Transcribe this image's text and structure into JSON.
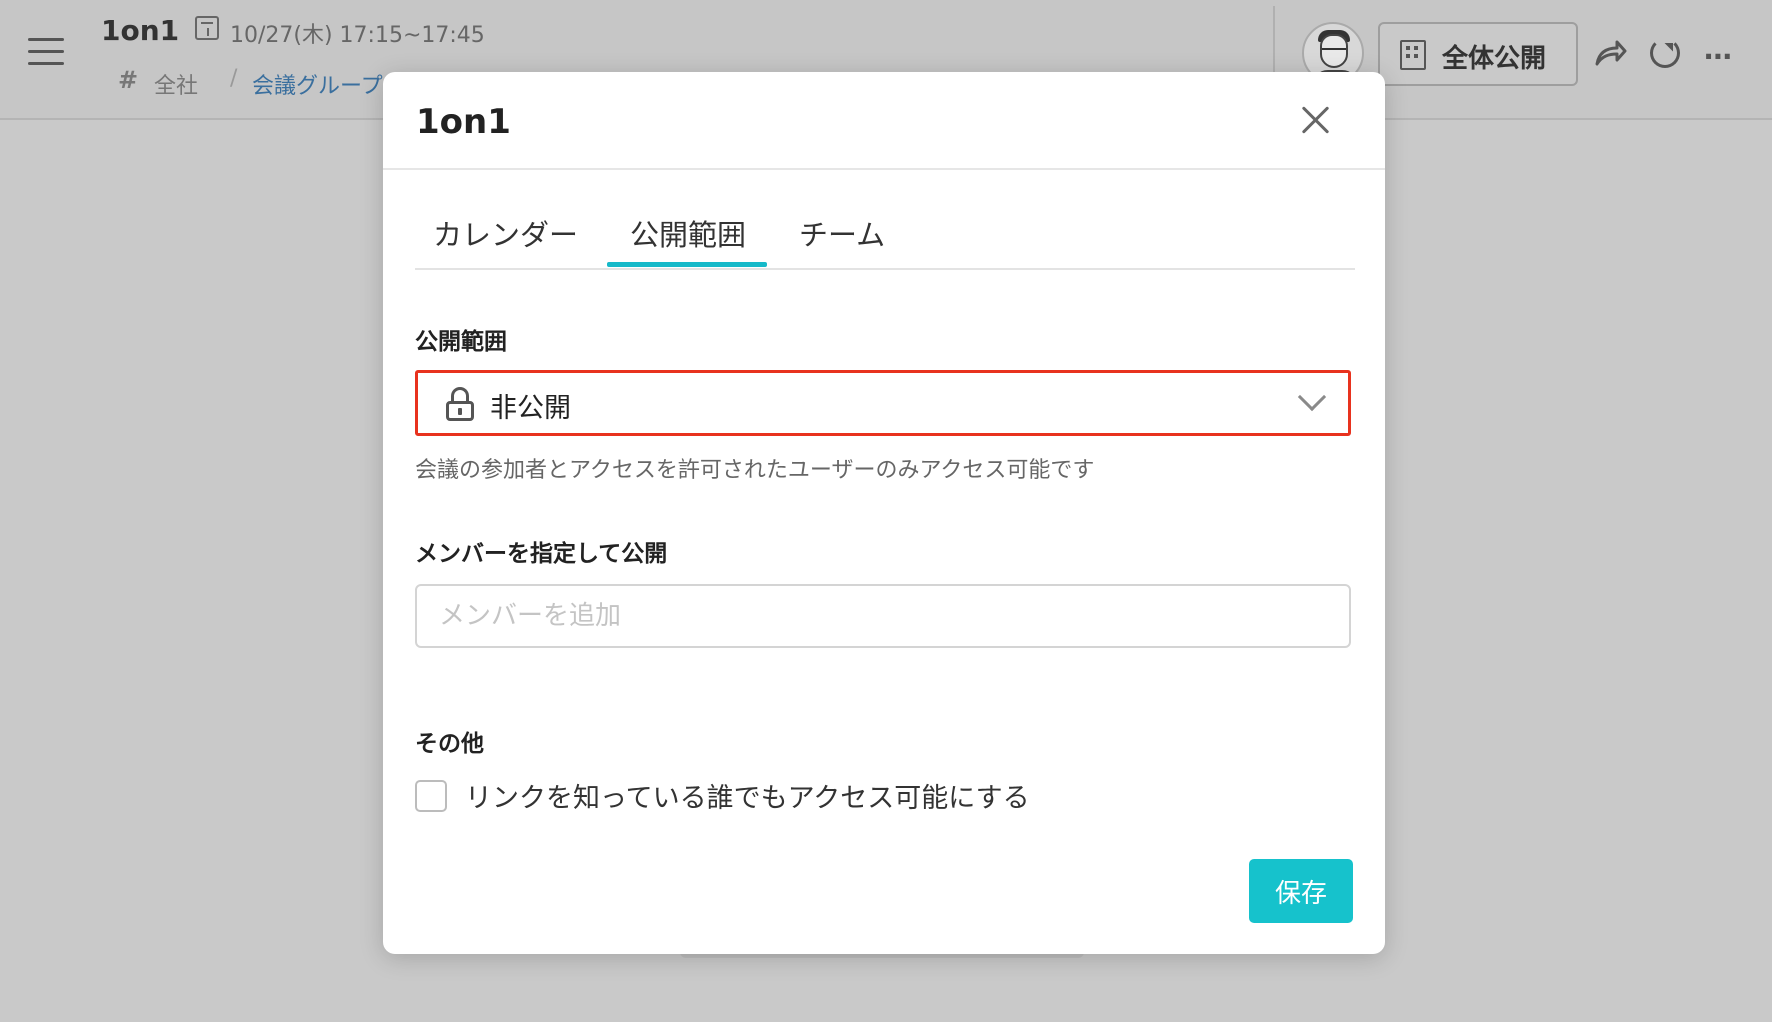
{
  "background": {
    "title": "1on1",
    "datetime": "10/27(木) 17:15~17:45",
    "breadcrumb": {
      "hash": "#",
      "company": "全社",
      "separator": "/",
      "group": "会議グループ"
    },
    "visibility_label": "全体公開"
  },
  "modal": {
    "title": "1on1",
    "tabs": [
      {
        "label": "カレンダー",
        "active": false
      },
      {
        "label": "公開範囲",
        "active": true
      },
      {
        "label": "チーム",
        "active": false
      }
    ],
    "visibility_section": {
      "label": "公開範囲",
      "selected": "非公開",
      "helper": "会議の参加者とアクセスを許可されたユーザーのみアクセス可能です"
    },
    "members_section": {
      "label": "メンバーを指定して公開",
      "placeholder": "メンバーを追加",
      "value": ""
    },
    "other_section": {
      "label": "その他",
      "link_access_label": "リンクを知っている誰でもアクセス可能にする",
      "link_access_checked": false
    },
    "save_label": "保存"
  },
  "colors": {
    "accent": "#16c2cc",
    "highlight_border": "#e8321e",
    "overlay": "#c9c9c9"
  }
}
